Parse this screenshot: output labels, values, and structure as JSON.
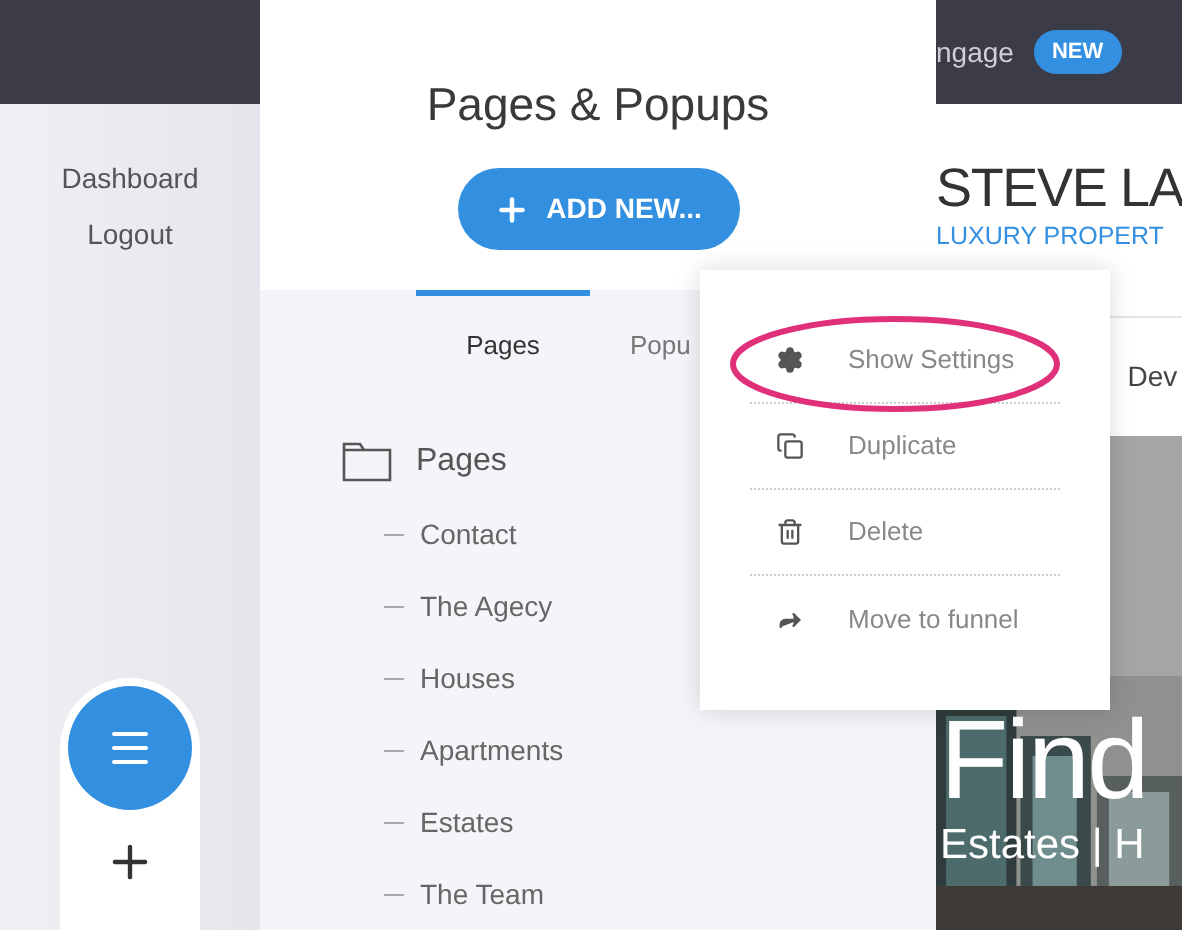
{
  "top_bar": {
    "text": "ngage",
    "badge": "NEW"
  },
  "sidebar": {
    "items": [
      "Dashboard",
      "Logout"
    ]
  },
  "panel": {
    "title": "Pages & Popups",
    "add_button": "ADD NEW...",
    "tabs": [
      {
        "label": "Pages",
        "selected": true
      },
      {
        "label": "Popu",
        "selected": false
      }
    ],
    "folder": {
      "label": "Pages",
      "children": [
        {
          "label": "Contact"
        },
        {
          "label": "The Agecy"
        },
        {
          "label": "Houses"
        },
        {
          "label": "Apartments"
        },
        {
          "label": "Estates"
        },
        {
          "label": "The Team"
        }
      ]
    }
  },
  "site_preview": {
    "heading": "STEVE LA",
    "subheading": "LUXURY PROPERT",
    "nav_item": "Dev",
    "hero_title": "Find",
    "hero_subtitle": "Estates | H"
  },
  "context_menu": {
    "items": [
      {
        "label": "Show Settings",
        "highlighted": true
      },
      {
        "label": "Duplicate",
        "highlighted": false
      },
      {
        "label": "Delete",
        "highlighted": false
      },
      {
        "label": "Move to funnel",
        "highlighted": false
      }
    ]
  }
}
